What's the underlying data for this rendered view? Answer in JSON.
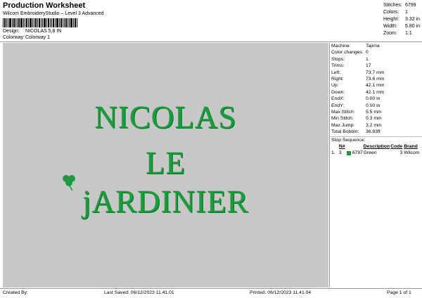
{
  "header": {
    "title": "Production Worksheet",
    "subtitle": "Wilcom EmbroideryStudio – Level 3 Advanced",
    "design_label": "Design:",
    "design_value": "NICOLAS 5,8 IN",
    "colorway_label": "Colorway:",
    "colorway_value": "Colorway 1"
  },
  "summary": [
    {
      "label": "Stitches:",
      "value": "6799"
    },
    {
      "label": "Colors:",
      "value": "1"
    },
    {
      "label": "Height:",
      "value": "3.32 in"
    },
    {
      "label": "Width:",
      "value": "5.80 in"
    },
    {
      "label": "Zoom:",
      "value": "1:1"
    }
  ],
  "design": {
    "lines": [
      "NICOLAS",
      "LE",
      "jARDINIER"
    ],
    "thread_color": "#1e9a3e",
    "background": "#c8c8c8"
  },
  "machine_stats": [
    {
      "label": "Machine:",
      "value": "Tajima"
    },
    {
      "label": "Color changes:",
      "value": "0"
    },
    {
      "label": "Stops:",
      "value": "1"
    },
    {
      "label": "Trims:",
      "value": "17"
    },
    {
      "label": "Left:",
      "value": "73.7 mm"
    },
    {
      "label": "Right:",
      "value": "73.6 mm"
    },
    {
      "label": "Up:",
      "value": "42.1 mm"
    },
    {
      "label": "Down:",
      "value": "42.1 mm"
    },
    {
      "label": "EndX:",
      "value": "0.00 in"
    },
    {
      "label": "EndY:",
      "value": "0.00 in"
    },
    {
      "label": "Max Stitch:",
      "value": "5.5 mm"
    },
    {
      "label": "Min Stitch:",
      "value": "0.3 mm"
    },
    {
      "label": "Max Jump:",
      "value": "3.2 mm"
    },
    {
      "label": "Total Bobbin:",
      "value": "36.93ft"
    }
  ],
  "stop_sequence": {
    "title": "Stop Sequence:",
    "headers": [
      "",
      "N#",
      "",
      "Description",
      "Code",
      "Brand"
    ],
    "rows": [
      {
        "stop": "1.",
        "n": "3",
        "code_num": "6797",
        "description": "Green",
        "code": "3",
        "brand": "Wilcom"
      }
    ]
  },
  "footer": {
    "created_by": "Created By:",
    "last_saved": "Last Saved: 06/12/2023 11.41.01",
    "printed": "Printed: 06/12/2023 11.41.04",
    "page": "Page 1 of 1"
  }
}
